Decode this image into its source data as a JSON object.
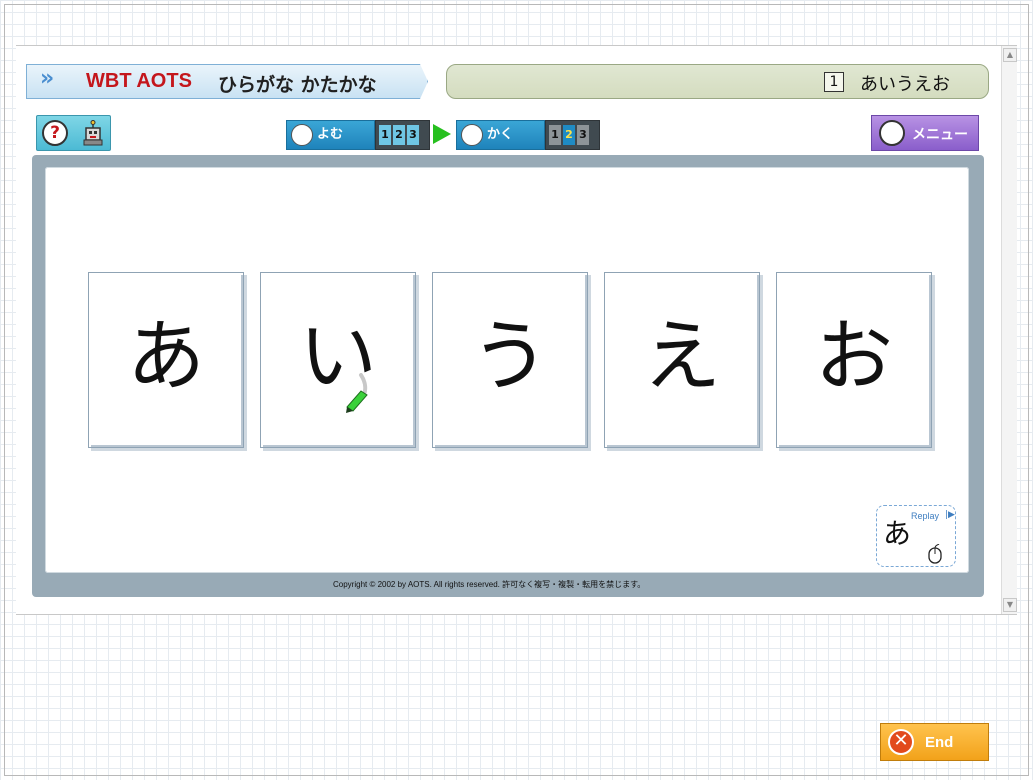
{
  "title": {
    "brand": "WBT AOTS",
    "subtitle": "ひらがな かたかな",
    "lesson_number": "1",
    "lesson_name": "あいうえお"
  },
  "toolbar": {
    "help_symbol": "?",
    "read_mode_label": "よむ",
    "read_steps": [
      "1",
      "2",
      "3"
    ],
    "write_mode_label": "かく",
    "write_steps": [
      "1",
      "2",
      "3"
    ],
    "menu_label": "メニュー"
  },
  "cards": [
    "あ",
    "い",
    "う",
    "え",
    "お"
  ],
  "replay": {
    "label": "Replay",
    "char": "あ"
  },
  "copyright": "Copyright © 2002 by AOTS. All rights reserved. 許可なく複写・複製・転用を禁じます。",
  "end_button": {
    "label": "End"
  },
  "colors": {
    "brand_red": "#c4161c",
    "mode_blue": "#1f83bb",
    "menu_purple": "#8a5ecb",
    "end_orange": "#f2a21a",
    "pen_green": "#27c01f"
  },
  "icons": [
    "help-icon",
    "robot-icon",
    "book-icon",
    "pencil-icon",
    "menu-icon",
    "mouse-icon",
    "close-x-icon"
  ]
}
